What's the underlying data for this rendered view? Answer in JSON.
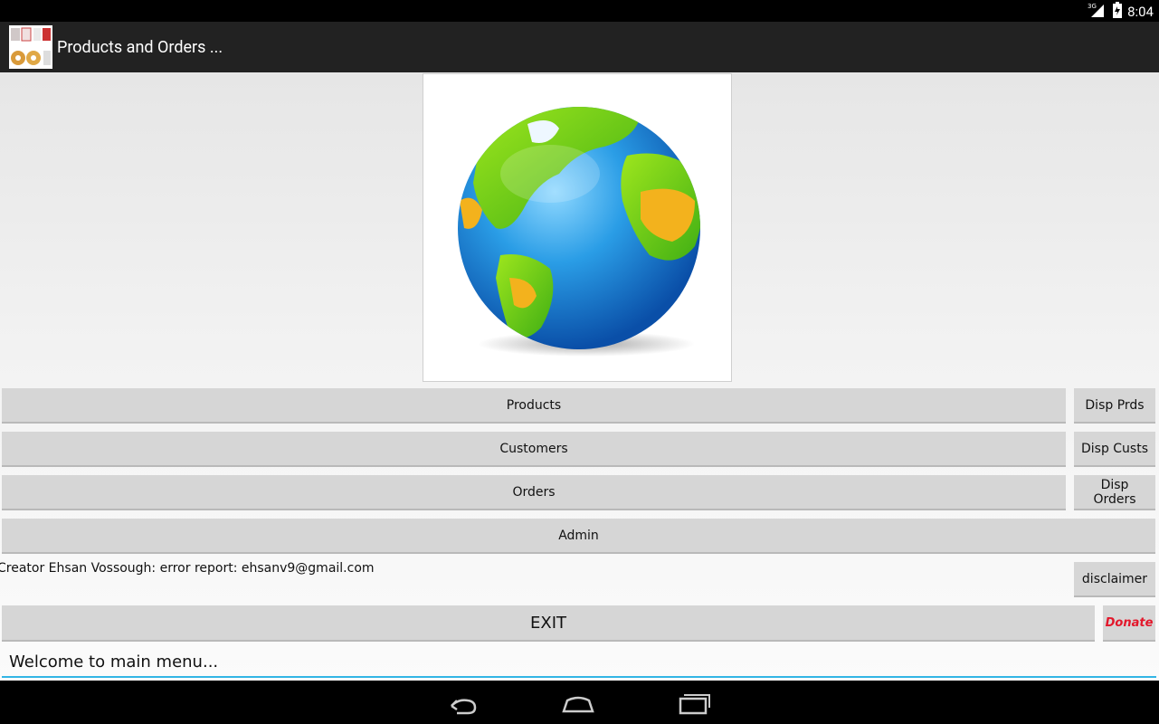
{
  "status_bar": {
    "network": "3G",
    "time": "8:04"
  },
  "action_bar": {
    "title": "Products and Orders ..."
  },
  "buttons": {
    "products": "Products",
    "disp_products": "Disp Prds",
    "customers": "Customers",
    "disp_customers": "Disp Custs",
    "orders": "Orders",
    "disp_orders": "Disp Orders",
    "admin": "Admin",
    "disclaimer": "disclaimer",
    "exit": "EXIT",
    "donate": "Donate"
  },
  "creator_text": "Creator Ehsan Vossough: error report: ehsanv9@gmail.com",
  "status_field": {
    "value": "Welcome to main menu..."
  },
  "colors": {
    "donate_red": "#e3172b",
    "accent_blue": "#33b5e5"
  },
  "icons": [
    "app-icon",
    "globe-image",
    "signal-icon",
    "battery-icon",
    "back-icon",
    "home-icon",
    "recents-icon"
  ]
}
